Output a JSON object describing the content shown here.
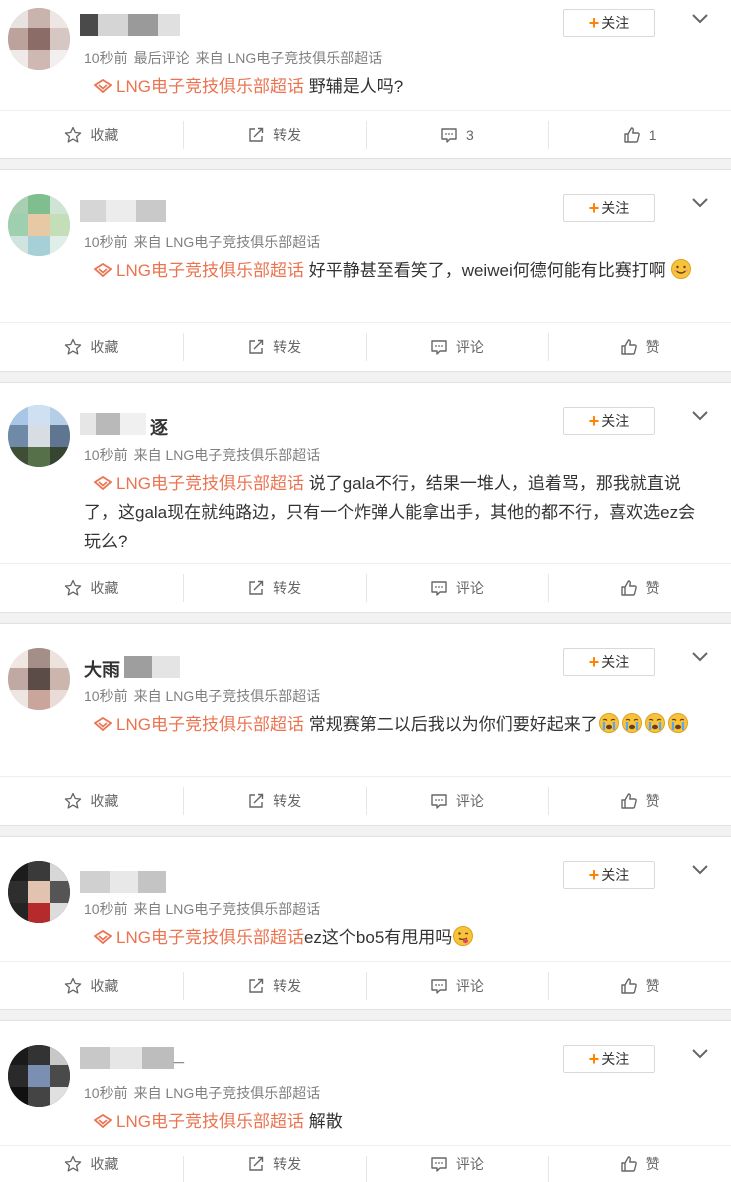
{
  "common": {
    "follow_label": "关注",
    "actions": {
      "favorite": "收藏",
      "repost": "转发",
      "comment": "评论",
      "like": "赞"
    },
    "topic_name": "LNG电子竞技俱乐部超话"
  },
  "posts": [
    {
      "username_visible": "",
      "meta": [
        "10秒前",
        "最后评论",
        "来自 LNG电子竞技俱乐部超话"
      ],
      "text": "野辅是人吗?",
      "comment_label": "3",
      "like_label": "1"
    },
    {
      "username_visible": "",
      "meta": [
        "10秒前",
        "来自 LNG电子竞技俱乐部超话"
      ],
      "text": "好平静甚至看笑了，weiwei何德何能有比赛打啊",
      "emoji": [
        "smile-emoji"
      ],
      "comment_label": "评论",
      "like_label": "赞"
    },
    {
      "username_visible": "逐",
      "meta": [
        "10秒前",
        "来自 LNG电子竞技俱乐部超话"
      ],
      "text": "说了gala不行，结果一堆人，追着骂，那我就直说了，这gala现在就纯路边，只有一个炸弹人能拿出手，其他的都不行，喜欢选ez会玩么?",
      "comment_label": "评论",
      "like_label": "赞"
    },
    {
      "username_visible": "大雨",
      "meta": [
        "10秒前",
        "来自 LNG电子竞技俱乐部超话"
      ],
      "text": "常规赛第二以后我以为你们要好起来了",
      "emoji": [
        "crying-emoji",
        "crying-emoji",
        "crying-emoji",
        "crying-emoji"
      ],
      "comment_label": "评论",
      "like_label": "赞"
    },
    {
      "username_visible": "",
      "meta": [
        "10秒前",
        "来自 LNG电子竞技俱乐部超话"
      ],
      "text": "ez这个bo5有甩用吗",
      "emoji": [
        "tongue-emoji"
      ],
      "comment_label": "评论",
      "like_label": "赞"
    },
    {
      "username_visible": "_",
      "meta": [
        "10秒前",
        "来自 LNG电子竞技俱乐部超话"
      ],
      "text": "解散",
      "comment_label": "评论",
      "like_label": "赞"
    }
  ],
  "colors": {
    "topic": "#eb7350",
    "follow_plus": "#ff8200",
    "background": "#f2f2f2",
    "emoji_yellow": "#f7c33b"
  }
}
